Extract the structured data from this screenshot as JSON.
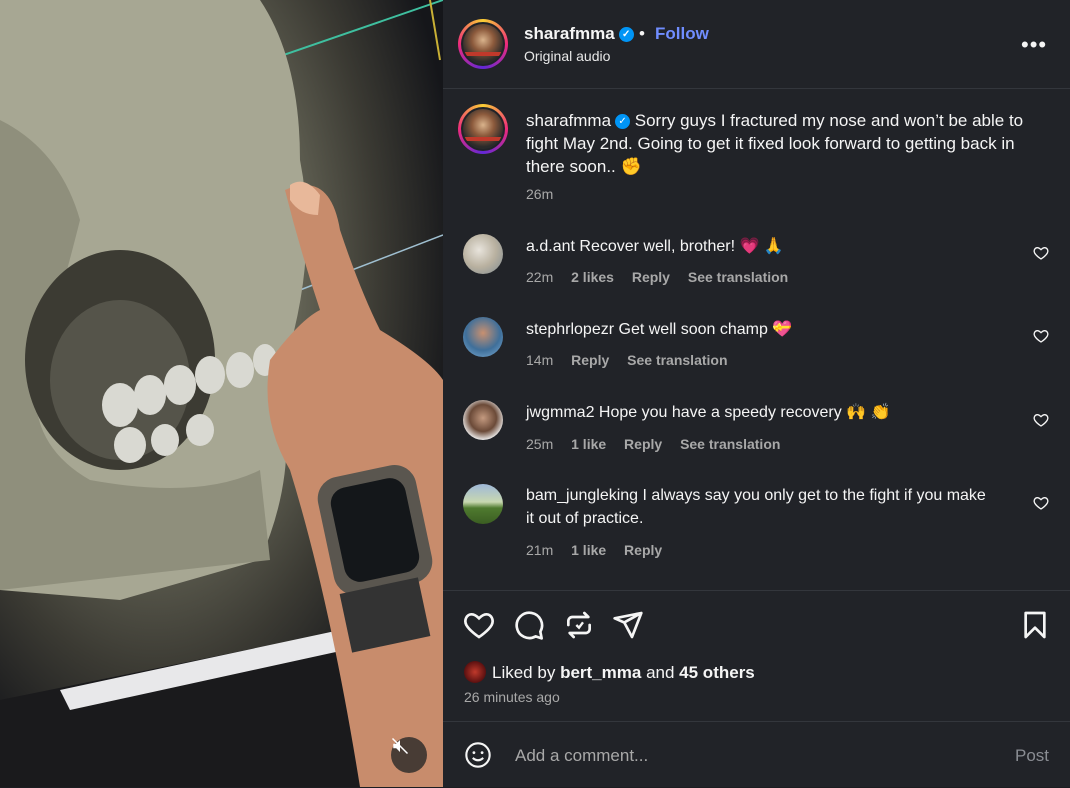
{
  "post": {
    "username": "sharafmma",
    "separator": "•",
    "follow_label": "Follow",
    "audio_label": "Original audio",
    "more_label": "•••",
    "caption_user": "sharafmma",
    "caption": "Sorry guys I fractured my nose and won’t be able to fight May 2nd. Going to get it fixed look forward to getting back in there soon.. ✊",
    "caption_time": "26m"
  },
  "comments": [
    {
      "user": "a.d.ant",
      "text": "Recover well, brother! 💗 🙏",
      "time": "22m",
      "likes": "2 likes",
      "reply": "Reply",
      "translate": "See translation"
    },
    {
      "user": "stephrlopezr",
      "text": "Get well soon champ 💝",
      "time": "14m",
      "reply": "Reply",
      "translate": "See translation"
    },
    {
      "user": "jwgmma2",
      "text": "Hope you have a speedy recovery 🙌 👏",
      "time": "25m",
      "likes": "1 like",
      "reply": "Reply",
      "translate": "See translation"
    },
    {
      "user": "bam_jungleking",
      "text": "I always say you only get to the fight if you make it out of practice.",
      "time": "21m",
      "likes": "1 like",
      "reply": "Reply"
    }
  ],
  "likes": {
    "prefix": "Liked by",
    "user": "bert_mma",
    "and": "and",
    "others": "45 others",
    "ago": "26 minutes ago"
  },
  "composer": {
    "placeholder": "Add a comment...",
    "post_label": "Post"
  },
  "colors": {
    "accent_link": "#708dff",
    "verified": "#0095f6",
    "panel_bg": "#212328",
    "muted_text": "#a8a8a8"
  }
}
